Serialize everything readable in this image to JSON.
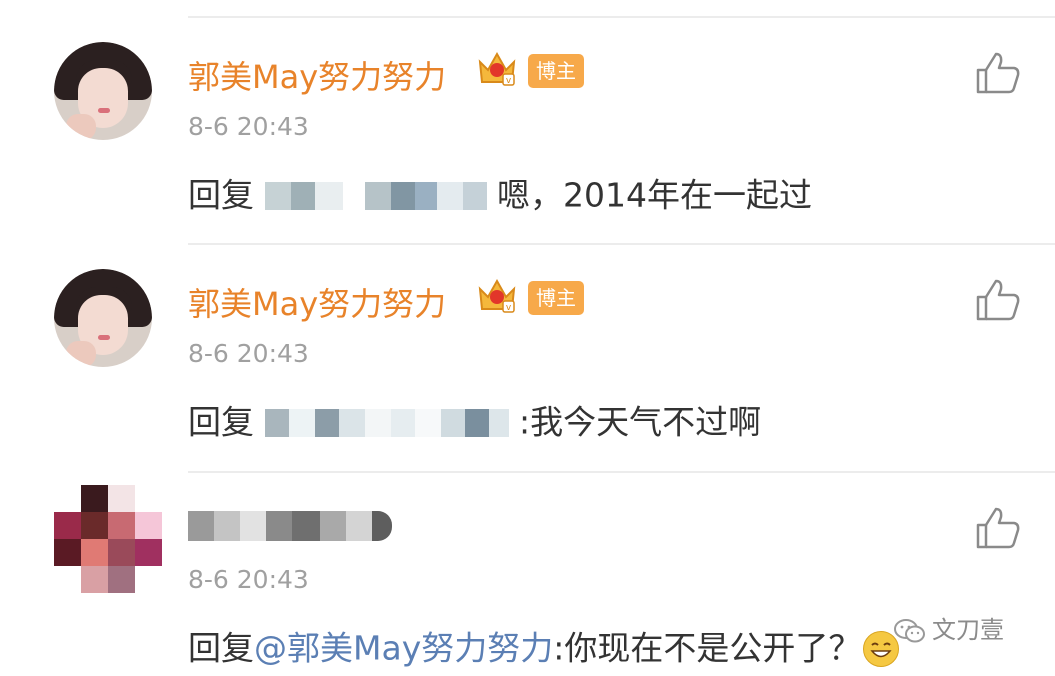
{
  "comments": [
    {
      "author": "郭美May努力努力",
      "badge": "博主",
      "time": "8-6 20:43",
      "reply_prefix": "回复",
      "reply_text": "嗯，2014年在一起过",
      "avatar": "portrait-avatar",
      "like_icon": "thumbs-up-icon"
    },
    {
      "author": "郭美May努力努力",
      "badge": "博主",
      "time": "8-6 20:43",
      "reply_prefix": "回复",
      "reply_text": ":我今天气不过啊",
      "avatar": "portrait-avatar",
      "like_icon": "thumbs-up-icon"
    },
    {
      "author": "",
      "time": "8-6 20:43",
      "reply_prefix": "回复",
      "mention": "@郭美May努力努力",
      "reply_text": ":你现在不是公开了？",
      "avatar": "pixelated-avatar",
      "like_icon": "thumbs-up-icon"
    }
  ],
  "watermark": {
    "text": "文刀壹",
    "icon": "wechat-icon"
  },
  "colors": {
    "name": "#e8832a",
    "badge": "#f7a94a",
    "mention": "#5b7fb4",
    "time": "#a0a0a0",
    "text": "#333333"
  }
}
